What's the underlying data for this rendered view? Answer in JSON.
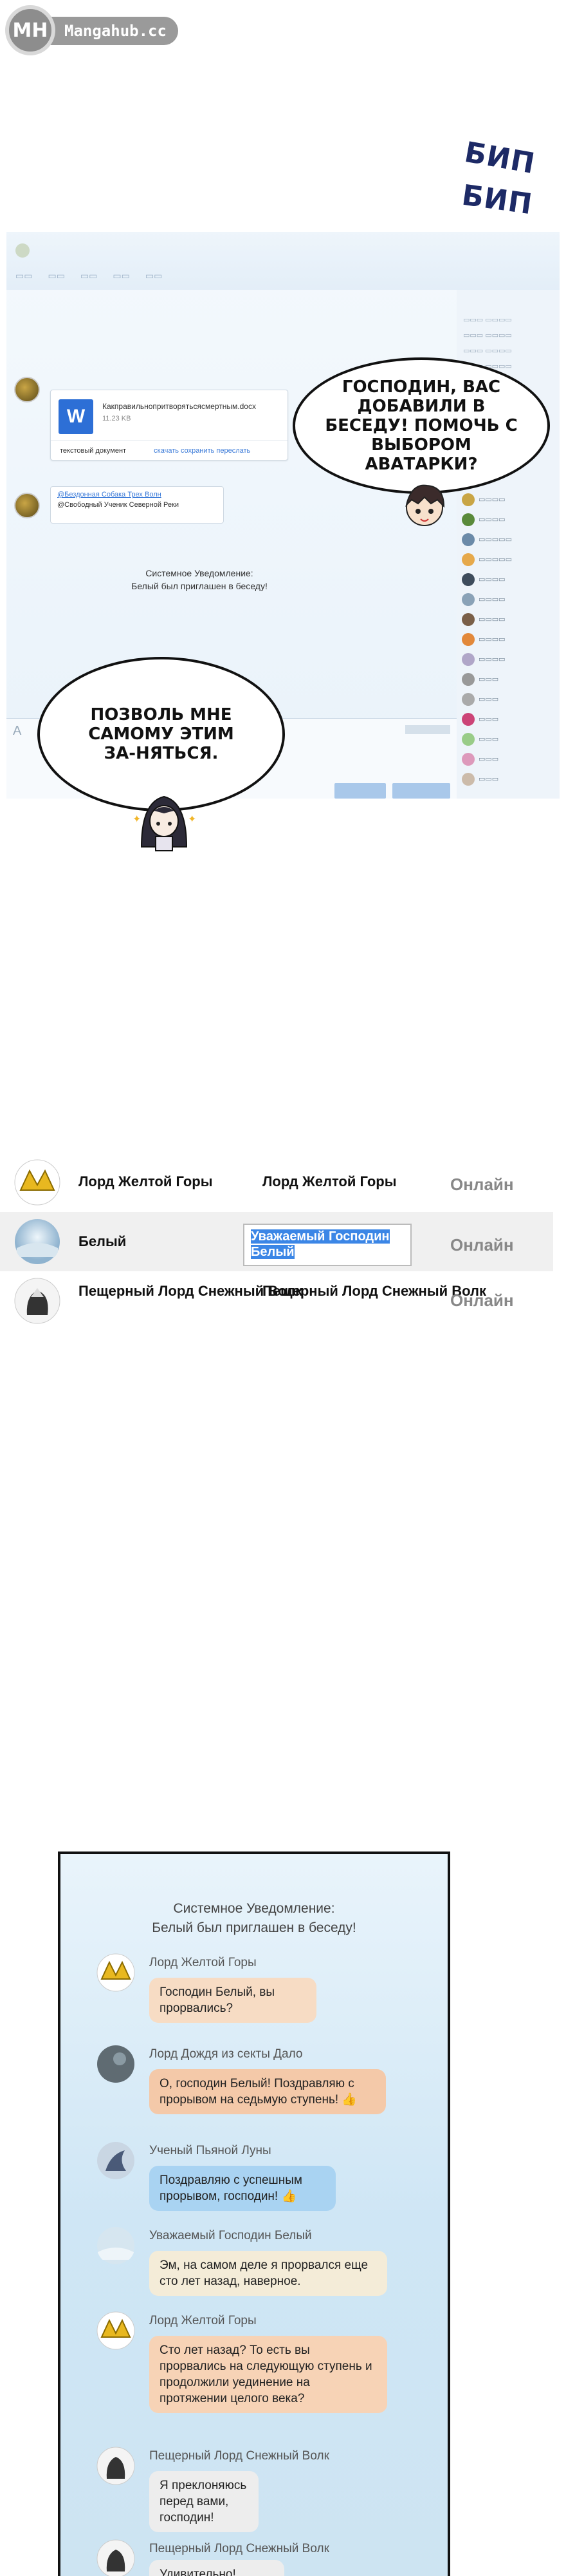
{
  "watermark": {
    "logo": "MH",
    "site": "Mangahub.cc"
  },
  "sfx": {
    "beep1": "БИП",
    "beep2": "БИП"
  },
  "panel1": {
    "file": {
      "icon_letter": "W",
      "name": "Какправильнопритворятьсясмертным.docx",
      "size": "11.23 KB",
      "type": "текстовый документ",
      "actions": "скачать сохранить переслать"
    },
    "link": {
      "line1": "@Бездонная Собака Трех Волн",
      "line2": "@Свободный Ученик Северной Реки"
    },
    "system_notice": [
      "Системное Уведомление:",
      "Белый был приглашен в беседу!"
    ],
    "bubble_right": "ГОСПОДИН, ВАС ДОБАВИЛИ В БЕСЕДУ! ПОМОЧЬ С ВЫБОРОМ АВАТАРКИ?",
    "bubble_left": "ПОЗВОЛЬ МНЕ САМОМУ ЭТИМ ЗА-НЯТЬСЯ."
  },
  "contacts": [
    {
      "name": "Лорд Желтой Горы",
      "nickname": "Лорд Желтой Горы",
      "status": "Онлайн",
      "selected": false
    },
    {
      "name": "Белый",
      "nickname": "Уважаемый Господин Белый",
      "status": "Онлайн",
      "selected": true
    },
    {
      "name": "Пещерный Лорд Снежный Волк",
      "nickname": "Пещерный Лорд Снежный Волк",
      "status": "Онлайн",
      "selected": false
    }
  ],
  "chat": {
    "system": [
      "Системное Уведомление:",
      "Белый был приглашен в беседу!"
    ],
    "messages": [
      {
        "author": "Лорд Желтой Горы",
        "text": "Господин Белый, вы прорвались?",
        "color": "#f7dcc4"
      },
      {
        "author": "Лорд Дождя из секты Дало",
        "text": "О, господин Белый! Поздравляю с прорывом на седьмую ступень! 👍",
        "color": "#f4c9a9"
      },
      {
        "author": "Ученый Пьяной Луны",
        "text": "Поздравляю с успешным прорывом, господин! 👍",
        "color": "#a9d3f2"
      },
      {
        "author": "Уважаемый Господин Белый",
        "text": "Эм, на самом деле я прорвался еще сто лет назад, наверное.",
        "color": "#f4ecd8"
      },
      {
        "author": "Лорд Желтой Горы",
        "text": "Сто лет назад? То есть вы прорвались на следующую ступень и продолжили уединение на протяжении целого века?",
        "color": "#f7d3b6"
      },
      {
        "author": "Пещерный Лорд Снежный Волк",
        "text": "Я преклоняюсь перед вами, господин!",
        "color": "#ededed"
      },
      {
        "author": "Пещерный Лорд Снежный Волк",
        "text": "Удивительно! Удивительно!",
        "color": "#ededed"
      }
    ]
  }
}
